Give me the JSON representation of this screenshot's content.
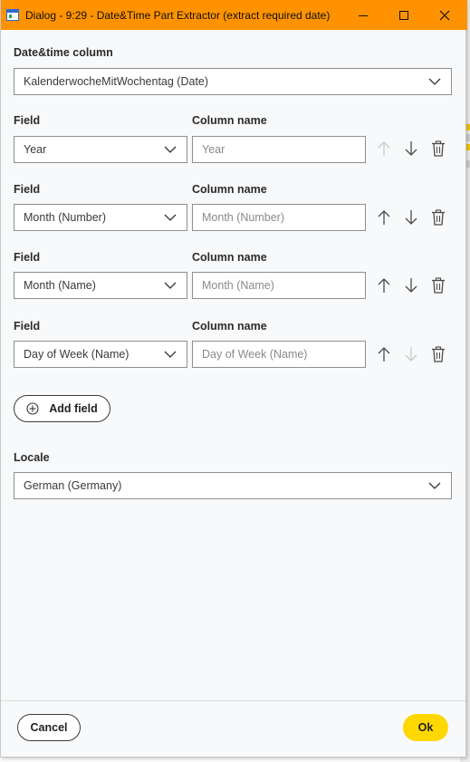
{
  "window": {
    "title": "Dialog - 9:29 - Date&Time Part Extractor (extract required date)"
  },
  "datetime_column": {
    "label": "Date&time column",
    "value": "KalenderwocheMitWochentag (Date)"
  },
  "fields": [
    {
      "field_label": "Field",
      "column_label": "Column name",
      "field_value": "Year",
      "column_placeholder": "Year",
      "up_enabled": false,
      "down_enabled": true
    },
    {
      "field_label": "Field",
      "column_label": "Column name",
      "field_value": "Month (Number)",
      "column_placeholder": "Month (Number)",
      "up_enabled": true,
      "down_enabled": true
    },
    {
      "field_label": "Field",
      "column_label": "Column name",
      "field_value": "Month (Name)",
      "column_placeholder": "Month (Name)",
      "up_enabled": true,
      "down_enabled": true
    },
    {
      "field_label": "Field",
      "column_label": "Column name",
      "field_value": "Day of Week (Name)",
      "column_placeholder": "Day of Week (Name)",
      "up_enabled": true,
      "down_enabled": false
    }
  ],
  "add_field_label": "Add field",
  "locale": {
    "label": "Locale",
    "value": "German (Germany)"
  },
  "footer": {
    "cancel_label": "Cancel",
    "ok_label": "Ok"
  },
  "colors": {
    "titlebar": "#ff9200",
    "ok_button": "#ffd700"
  }
}
